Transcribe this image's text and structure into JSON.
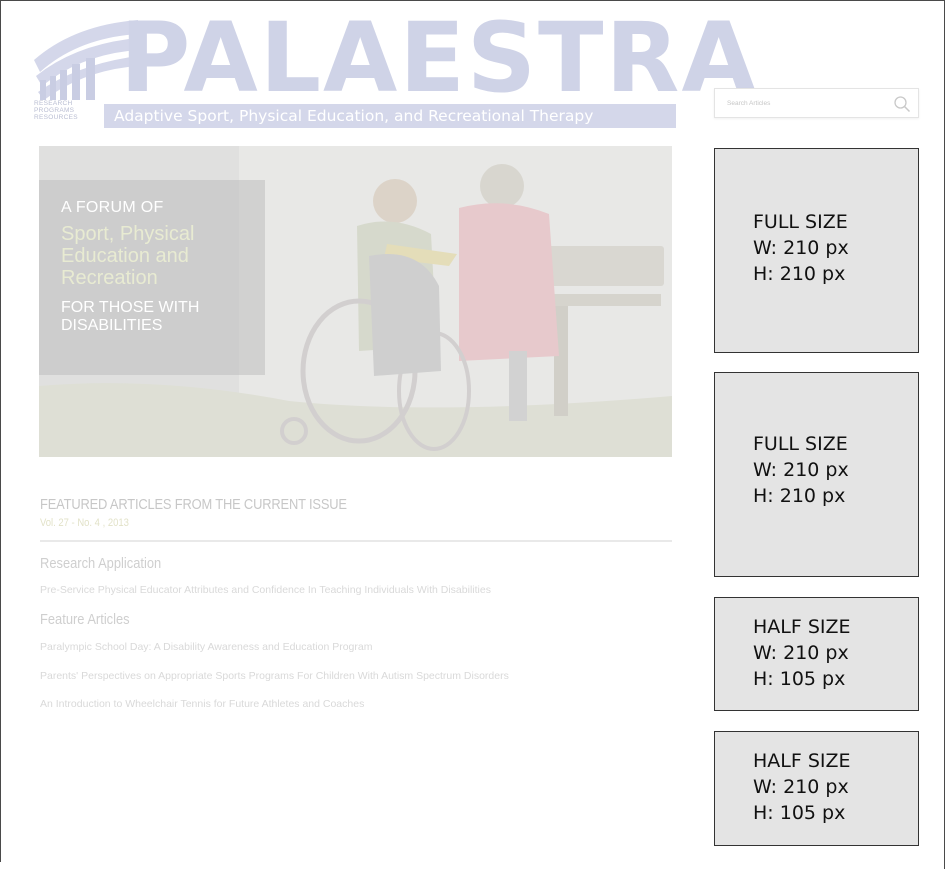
{
  "logo": {
    "title": "PALAESTRA",
    "tagline": "Adaptive Sport, Physical Education, and Recreational Therapy",
    "rpr_line1": "RESEARCH",
    "rpr_line2": "PROGRAMS",
    "rpr_line3": "RESOURCES",
    "color": "#cfd3e7"
  },
  "search": {
    "placeholder": "Search Articles",
    "icon": "search-icon"
  },
  "hero": {
    "line1": "A FORUM OF",
    "line2a": "Sport, Physical",
    "line2b": "Education and",
    "line2c": "Recreation",
    "line3a": "FOR THOSE WITH",
    "line3b": "DISABILITIES"
  },
  "featured": {
    "title": "FEATURED ARTICLES FROM THE CURRENT ISSUE",
    "issue": "Vol. 27 - No. 4 , 2013",
    "sections": [
      {
        "heading": "Research Application",
        "articles": [
          "Pre-Service Physical Educator Attributes and Confidence In Teaching Individuals With Disabilities"
        ]
      },
      {
        "heading": "Feature Articles",
        "articles": [
          "Paralympic School Day: A Disability Awareness and Education Program",
          "Parents' Perspectives on Appropriate Sports Programs For Children With Autism Spectrum Disorders",
          "An Introduction to Wheelchair Tennis for Future Athletes and Coaches"
        ]
      }
    ]
  },
  "ads": [
    {
      "size": "FULL SIZE",
      "w": "W: 210 px",
      "h": "H: 210 px"
    },
    {
      "size": "FULL SIZE",
      "w": "W: 210 px",
      "h": "H: 210 px"
    },
    {
      "size": "HALF SIZE",
      "w": "W: 210 px",
      "h": "H: 105 px"
    },
    {
      "size": "HALF SIZE",
      "w": "W: 210 px",
      "h": "H: 105 px"
    }
  ]
}
